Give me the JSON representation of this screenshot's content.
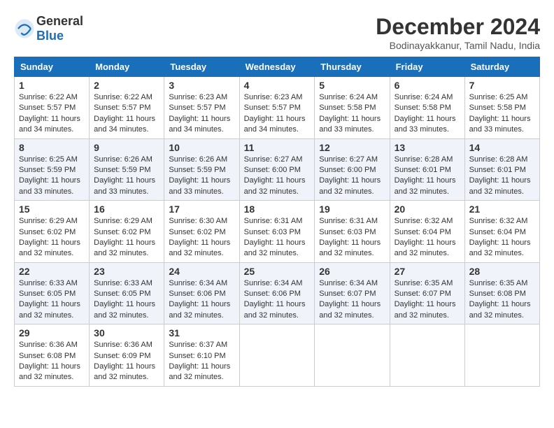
{
  "header": {
    "logo_general": "General",
    "logo_blue": "Blue",
    "month_title": "December 2024",
    "location": "Bodinayakkanur, Tamil Nadu, India"
  },
  "calendar": {
    "days_of_week": [
      "Sunday",
      "Monday",
      "Tuesday",
      "Wednesday",
      "Thursday",
      "Friday",
      "Saturday"
    ],
    "weeks": [
      [
        null,
        {
          "day": "2",
          "sunrise": "6:22 AM",
          "sunset": "5:57 PM",
          "daylight": "11 hours and 34 minutes."
        },
        {
          "day": "3",
          "sunrise": "6:23 AM",
          "sunset": "5:57 PM",
          "daylight": "11 hours and 34 minutes."
        },
        {
          "day": "4",
          "sunrise": "6:23 AM",
          "sunset": "5:57 PM",
          "daylight": "11 hours and 34 minutes."
        },
        {
          "day": "5",
          "sunrise": "6:24 AM",
          "sunset": "5:58 PM",
          "daylight": "11 hours and 33 minutes."
        },
        {
          "day": "6",
          "sunrise": "6:24 AM",
          "sunset": "5:58 PM",
          "daylight": "11 hours and 33 minutes."
        },
        {
          "day": "7",
          "sunrise": "6:25 AM",
          "sunset": "5:58 PM",
          "daylight": "11 hours and 33 minutes."
        }
      ],
      [
        {
          "day": "1",
          "sunrise": "6:22 AM",
          "sunset": "5:57 PM",
          "daylight": "11 hours and 34 minutes."
        },
        null,
        null,
        null,
        null,
        null,
        null
      ],
      [
        {
          "day": "8",
          "sunrise": "6:25 AM",
          "sunset": "5:59 PM",
          "daylight": "11 hours and 33 minutes."
        },
        {
          "day": "9",
          "sunrise": "6:26 AM",
          "sunset": "5:59 PM",
          "daylight": "11 hours and 33 minutes."
        },
        {
          "day": "10",
          "sunrise": "6:26 AM",
          "sunset": "5:59 PM",
          "daylight": "11 hours and 33 minutes."
        },
        {
          "day": "11",
          "sunrise": "6:27 AM",
          "sunset": "6:00 PM",
          "daylight": "11 hours and 32 minutes."
        },
        {
          "day": "12",
          "sunrise": "6:27 AM",
          "sunset": "6:00 PM",
          "daylight": "11 hours and 32 minutes."
        },
        {
          "day": "13",
          "sunrise": "6:28 AM",
          "sunset": "6:01 PM",
          "daylight": "11 hours and 32 minutes."
        },
        {
          "day": "14",
          "sunrise": "6:28 AM",
          "sunset": "6:01 PM",
          "daylight": "11 hours and 32 minutes."
        }
      ],
      [
        {
          "day": "15",
          "sunrise": "6:29 AM",
          "sunset": "6:02 PM",
          "daylight": "11 hours and 32 minutes."
        },
        {
          "day": "16",
          "sunrise": "6:29 AM",
          "sunset": "6:02 PM",
          "daylight": "11 hours and 32 minutes."
        },
        {
          "day": "17",
          "sunrise": "6:30 AM",
          "sunset": "6:02 PM",
          "daylight": "11 hours and 32 minutes."
        },
        {
          "day": "18",
          "sunrise": "6:31 AM",
          "sunset": "6:03 PM",
          "daylight": "11 hours and 32 minutes."
        },
        {
          "day": "19",
          "sunrise": "6:31 AM",
          "sunset": "6:03 PM",
          "daylight": "11 hours and 32 minutes."
        },
        {
          "day": "20",
          "sunrise": "6:32 AM",
          "sunset": "6:04 PM",
          "daylight": "11 hours and 32 minutes."
        },
        {
          "day": "21",
          "sunrise": "6:32 AM",
          "sunset": "6:04 PM",
          "daylight": "11 hours and 32 minutes."
        }
      ],
      [
        {
          "day": "22",
          "sunrise": "6:33 AM",
          "sunset": "6:05 PM",
          "daylight": "11 hours and 32 minutes."
        },
        {
          "day": "23",
          "sunrise": "6:33 AM",
          "sunset": "6:05 PM",
          "daylight": "11 hours and 32 minutes."
        },
        {
          "day": "24",
          "sunrise": "6:34 AM",
          "sunset": "6:06 PM",
          "daylight": "11 hours and 32 minutes."
        },
        {
          "day": "25",
          "sunrise": "6:34 AM",
          "sunset": "6:06 PM",
          "daylight": "11 hours and 32 minutes."
        },
        {
          "day": "26",
          "sunrise": "6:34 AM",
          "sunset": "6:07 PM",
          "daylight": "11 hours and 32 minutes."
        },
        {
          "day": "27",
          "sunrise": "6:35 AM",
          "sunset": "6:07 PM",
          "daylight": "11 hours and 32 minutes."
        },
        {
          "day": "28",
          "sunrise": "6:35 AM",
          "sunset": "6:08 PM",
          "daylight": "11 hours and 32 minutes."
        }
      ],
      [
        {
          "day": "29",
          "sunrise": "6:36 AM",
          "sunset": "6:08 PM",
          "daylight": "11 hours and 32 minutes."
        },
        {
          "day": "30",
          "sunrise": "6:36 AM",
          "sunset": "6:09 PM",
          "daylight": "11 hours and 32 minutes."
        },
        {
          "day": "31",
          "sunrise": "6:37 AM",
          "sunset": "6:10 PM",
          "daylight": "11 hours and 32 minutes."
        },
        null,
        null,
        null,
        null
      ]
    ]
  }
}
